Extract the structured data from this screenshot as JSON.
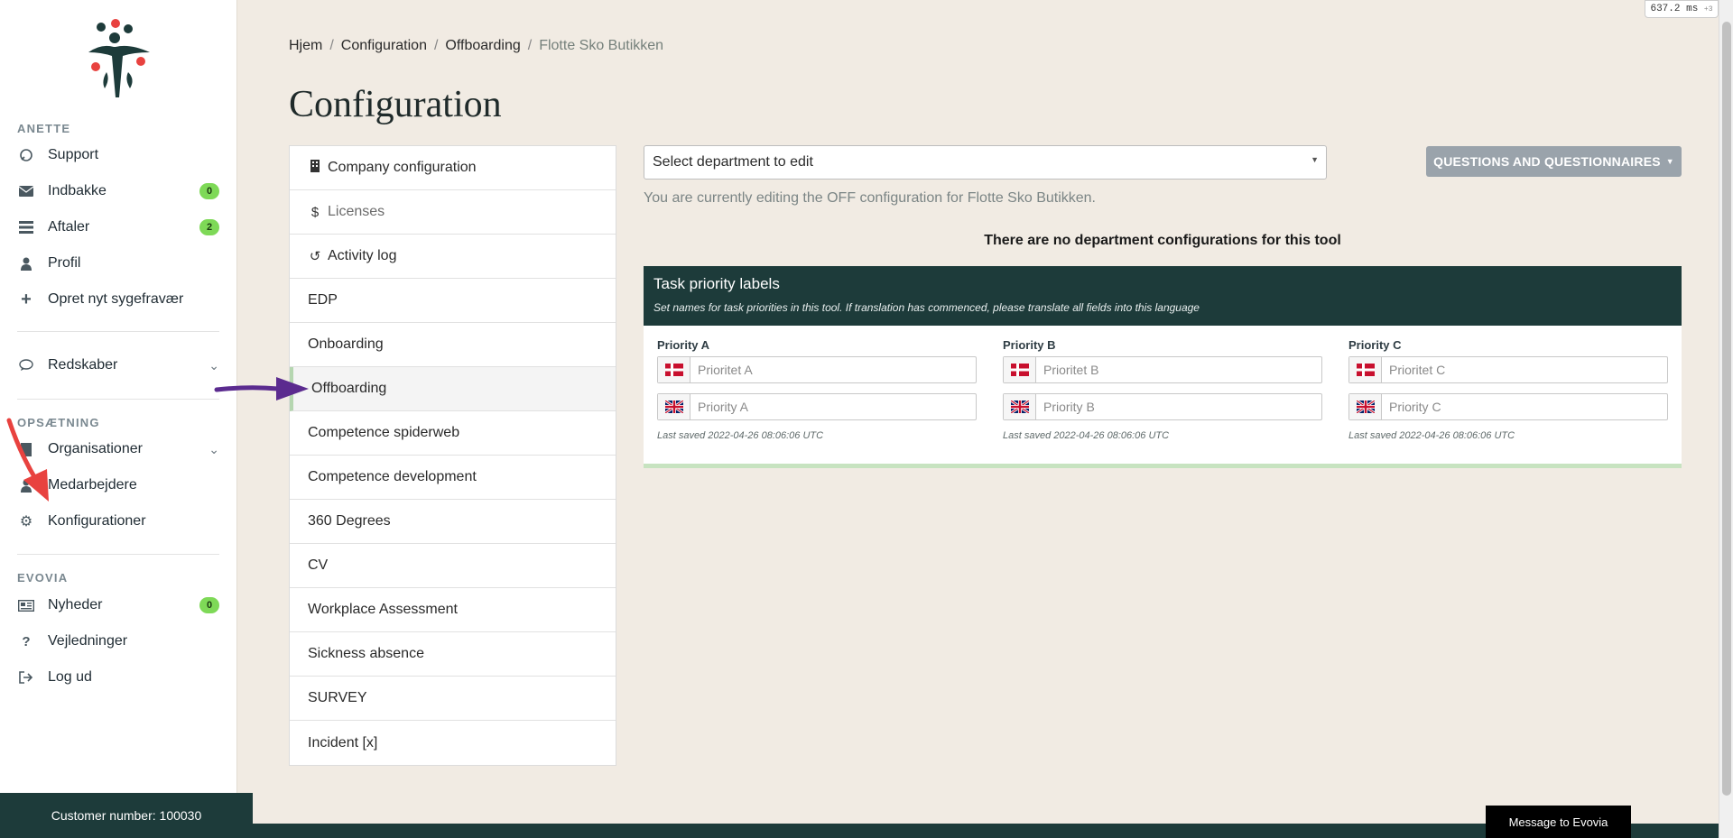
{
  "sidebar": {
    "user_section": "ANETTE",
    "items": [
      {
        "label": "Support",
        "icon": "support-icon"
      },
      {
        "label": "Indbakke",
        "icon": "envelope-icon",
        "badge": "0"
      },
      {
        "label": "Aftaler",
        "icon": "list-icon",
        "badge": "2"
      },
      {
        "label": "Profil",
        "icon": "user-icon"
      },
      {
        "label": "Opret nyt sygefravær",
        "icon": "plus-icon"
      }
    ],
    "tools": {
      "label": "Redskaber",
      "icon": "chat-icon"
    },
    "setup_section": "OPSÆTNING",
    "setup_items": [
      {
        "label": "Organisationer",
        "icon": "building-icon"
      },
      {
        "label": "Medarbejdere",
        "icon": "user-icon"
      },
      {
        "label": "Konfigurationer",
        "icon": "gear-icon"
      }
    ],
    "evovia_section": "EVOVIA",
    "evovia_items": [
      {
        "label": "Nyheder",
        "icon": "newspaper-icon",
        "badge": "0"
      },
      {
        "label": "Vejledninger",
        "icon": "question-icon"
      },
      {
        "label": "Log ud",
        "icon": "logout-icon"
      }
    ],
    "customer_number": "Customer number: 100030"
  },
  "breadcrumb": {
    "items": [
      "Hjem",
      "Configuration",
      "Offboarding"
    ],
    "current": "Flotte Sko Butikken",
    "separator": "/"
  },
  "page_title": "Configuration",
  "config_menu": [
    {
      "label": "Company configuration",
      "icon": "building-icon"
    },
    {
      "label": "Licenses",
      "icon": "dollar-icon"
    },
    {
      "label": "Activity log",
      "icon": "history-icon"
    },
    {
      "label": "EDP"
    },
    {
      "label": "Onboarding"
    },
    {
      "label": "Offboarding",
      "active": true
    },
    {
      "label": "Competence spiderweb"
    },
    {
      "label": "Competence development"
    },
    {
      "label": "360 Degrees"
    },
    {
      "label": "CV"
    },
    {
      "label": "Workplace Assessment"
    },
    {
      "label": "Sickness absence"
    },
    {
      "label": "SURVEY"
    },
    {
      "label": "Incident [x]"
    }
  ],
  "department_select": {
    "value": "Select department to edit"
  },
  "questions_button": "QUESTIONS AND QUESTIONNAIRES",
  "edit_note": "You are currently editing the OFF configuration for Flotte Sko Butikken.",
  "no_department_configs": "There are no department configurations for this tool",
  "task_priority": {
    "title": "Task priority labels",
    "subtitle": "Set names for task priorities in this tool. If translation has commenced, please translate all fields into this language",
    "columns": [
      {
        "label": "Priority A",
        "da_placeholder": "Prioritet A",
        "en_placeholder": "Priority A",
        "last_saved": "Last saved 2022-04-26 08:06:06 UTC"
      },
      {
        "label": "Priority B",
        "da_placeholder": "Prioritet B",
        "en_placeholder": "Priority B",
        "last_saved": "Last saved 2022-04-26 08:06:06 UTC"
      },
      {
        "label": "Priority C",
        "da_placeholder": "Prioritet C",
        "en_placeholder": "Priority C",
        "last_saved": "Last saved 2022-04-26 08:06:06 UTC"
      }
    ]
  },
  "message_button": "Message to Evovia",
  "perf_readout": "637.2 ms",
  "perf_suffix": "+3",
  "colors": {
    "brand_dark": "#1d3b3a",
    "badge_green": "#7ed957",
    "page_bg": "#f1ebe3",
    "annotation_purple": "#5b2b8f",
    "annotation_red": "#e8423f"
  }
}
